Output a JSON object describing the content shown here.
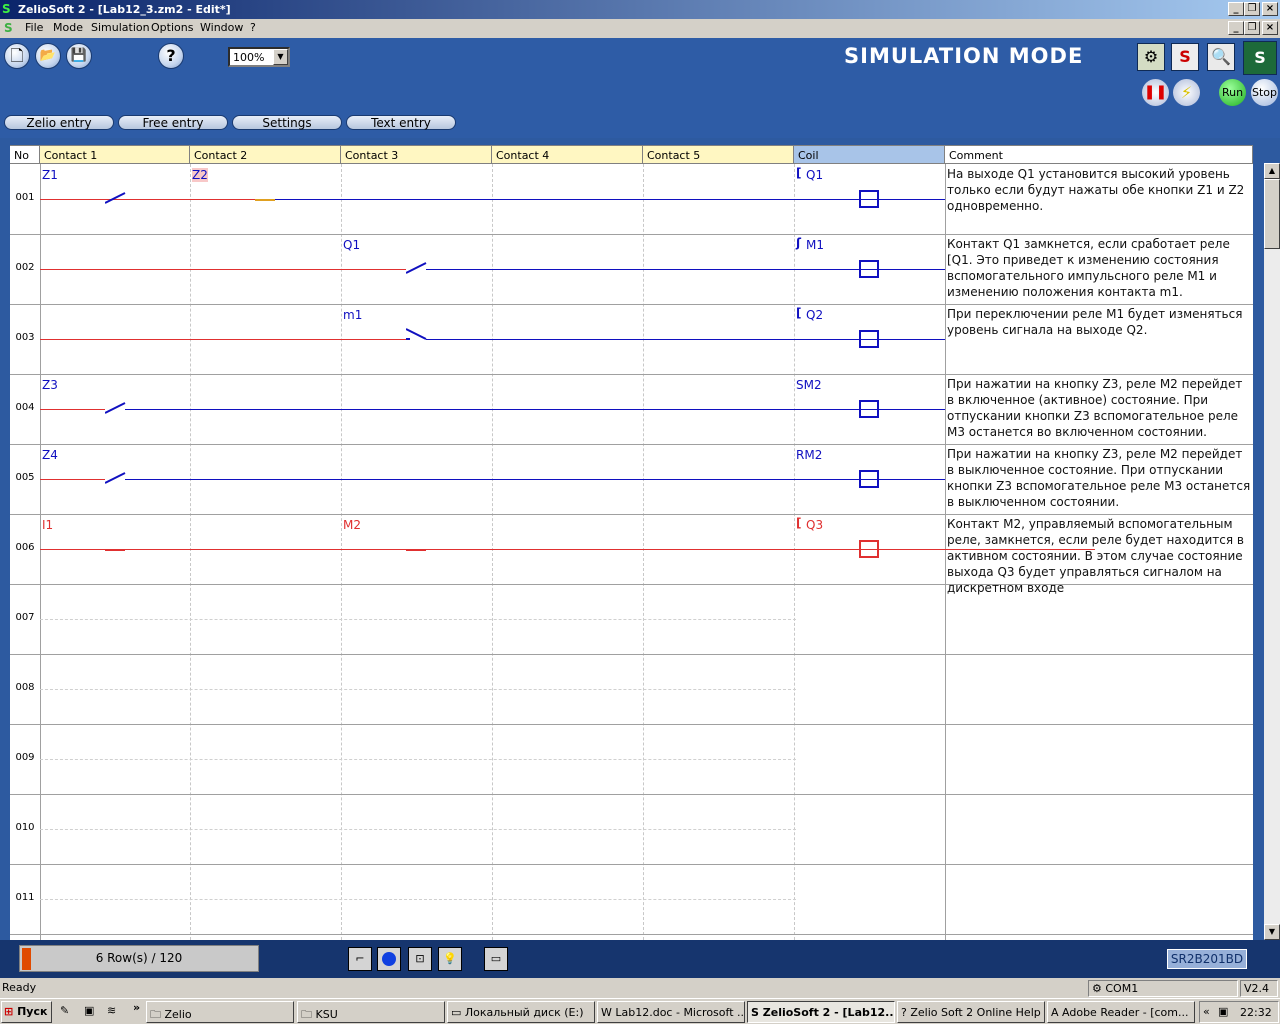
{
  "window": {
    "title": "ZelioSoft 2 - [Lab12_3.zm2 - Edit*]"
  },
  "menu": [
    "File",
    "Mode",
    "Simulation",
    "Options",
    "Window",
    "?"
  ],
  "toolbar": {
    "zoom": "100%",
    "help": "?",
    "mode_label": "SIMULATION MODE",
    "s_label": "S",
    "run": "Run",
    "stop": "Stop"
  },
  "tabs": [
    "Zelio entry",
    "Free entry",
    "Settings",
    "Text entry"
  ],
  "grid": {
    "headers": [
      "No",
      "Contact 1",
      "Contact 2",
      "Contact 3",
      "Contact 4",
      "Contact 5",
      "Coil",
      "Comment"
    ],
    "rows": [
      {
        "no": "001",
        "contacts": [
          "Z1",
          "Z2",
          "",
          "",
          "",
          ""
        ],
        "coil": "Q1",
        "coil_prefix": "[",
        "comment": "На выходе Q1 установится высокий уровень только если будут нажаты обе кнопки Z1 и Z2 одновременно."
      },
      {
        "no": "002",
        "contacts": [
          "",
          "",
          "Q1",
          "",
          "",
          ""
        ],
        "coil": "M1",
        "coil_prefix": "ʃ",
        "comment": "Контакт Q1 замкнется, если сработает реле [Q1. Это приведет к изменению состояния вспомогательного импульсного реле M1 и изменению положения контакта m1."
      },
      {
        "no": "003",
        "contacts": [
          "",
          "",
          "m1",
          "",
          "",
          ""
        ],
        "coil": "Q2",
        "coil_prefix": "[",
        "comment": "При переключении реле M1 будет изменяться уровень сигнала на выходе Q2."
      },
      {
        "no": "004",
        "contacts": [
          "Z3",
          "",
          "",
          "",
          "",
          ""
        ],
        "coil": "SM2",
        "coil_prefix": "",
        "comment": "При нажатии на кнопку Z3, реле M2 перейдет в включенное (активное) состояние. При отпускании кнопки Z3 вспомогательное реле M3 останется во включенном состоянии."
      },
      {
        "no": "005",
        "contacts": [
          "Z4",
          "",
          "",
          "",
          "",
          ""
        ],
        "coil": "RM2",
        "coil_prefix": "",
        "comment": "При нажатии на кнопку Z3, реле M2 перейдет в выключенное состояние. При отпускании кнопки Z3 вспомогательное реле M3 останется в выключенном состоянии."
      },
      {
        "no": "006",
        "contacts": [
          "I1",
          "",
          "M2",
          "",
          "",
          ""
        ],
        "coil": "Q3",
        "coil_prefix": "[",
        "comment": "Контакт M2, управляемый вспомогательным реле, замкнется, если реле будет находится в активном состоянии. В этом случае состояние выхода Q3 будет управляться сигналом на дискретном входе"
      },
      {
        "no": "007"
      },
      {
        "no": "008"
      },
      {
        "no": "009"
      },
      {
        "no": "010"
      },
      {
        "no": "011"
      }
    ]
  },
  "colors": {
    "active_wire": "#e03030",
    "inactive_wire": "#1010c0",
    "header_bg": "#fff7c2",
    "coil_header_bg": "#a8c4e8"
  },
  "bottom": {
    "rows_info": "6 Row(s) / 120",
    "model": "SR2B201BD"
  },
  "status": {
    "text": "Ready",
    "port": "COM1",
    "version": "V2.4"
  },
  "taskbar": {
    "start": "Пуск",
    "items": [
      "Zelio",
      "KSU",
      "Локальный диск (E:)",
      "Lab12.doc - Microsoft ...",
      "ZelioSoft 2 - [Lab12...",
      "Zelio Soft 2 Online Help",
      "Adobe Reader - [com..."
    ],
    "clock": "22:32"
  }
}
